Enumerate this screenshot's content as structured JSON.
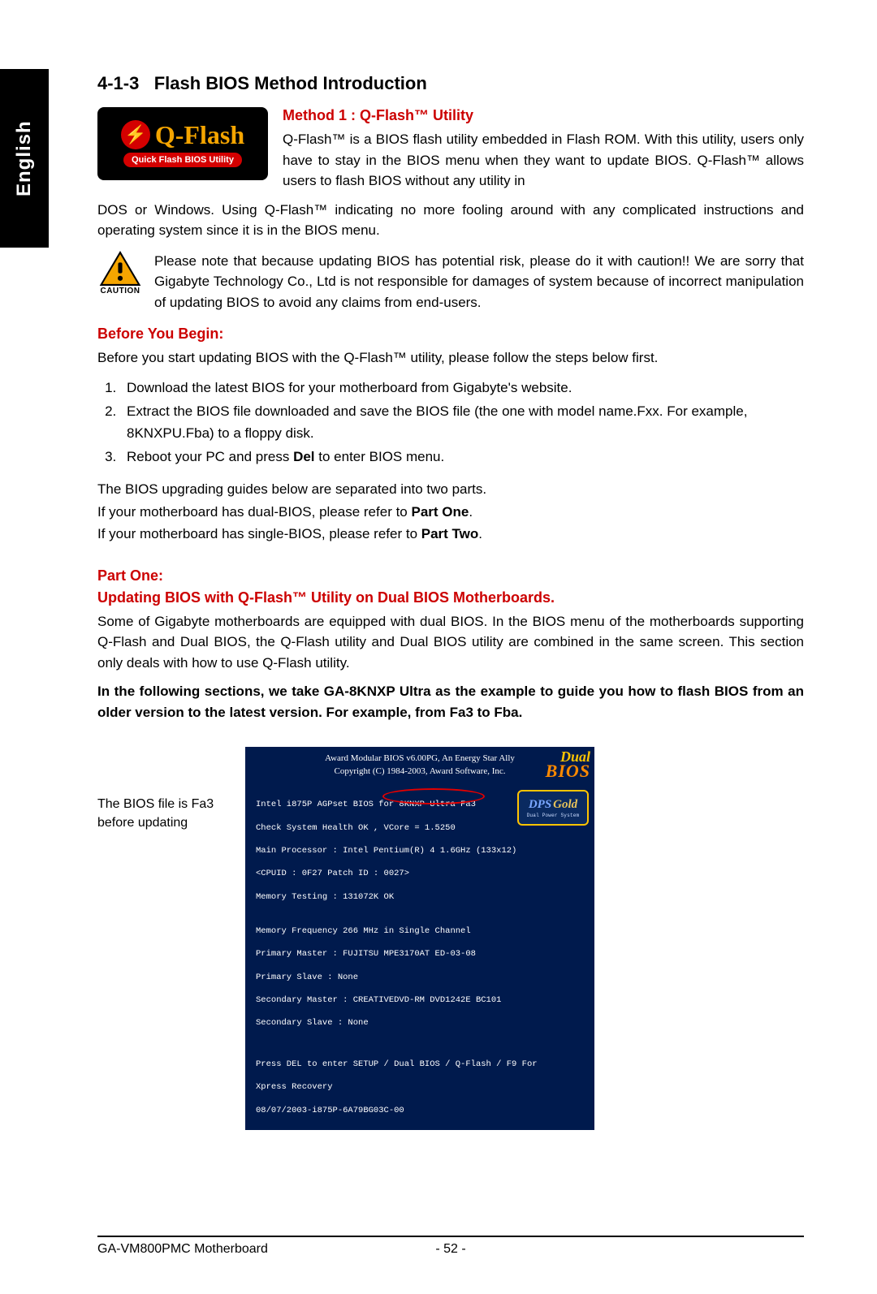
{
  "lang_tab": "English",
  "section_number": "4-1-3",
  "section_title": "Flash BIOS Method Introduction",
  "qflash_logo": {
    "main": "Q-Flash",
    "subtitle": "Quick Flash BIOS Utility",
    "symbol": "⚡"
  },
  "method_title": "Method 1 : Q-Flash™ Utility",
  "intro_paragraph_inline": "Q-Flash™ is a BIOS flash utility embedded in Flash ROM. With this utility, users only have to stay in the BIOS menu when they want to update BIOS. Q-Flash™ allows users to flash BIOS without any utility in",
  "intro_paragraph_cont": "DOS or Windows. Using Q-Flash™ indicating no more fooling around with any complicated instructions and operating system since it is in the BIOS menu.",
  "caution_label": "CAUTION",
  "caution_text": "Please note that because updating BIOS has potential risk, please do it with caution!! We are sorry that Gigabyte Technology Co., Ltd is not responsible for damages of system because of incorrect manipulation of updating BIOS to avoid any claims from end-users.",
  "before_heading": "Before You Begin:",
  "before_para": "Before you start updating BIOS with the Q-Flash™ utility, please follow the steps below first.",
  "steps": [
    "Download the latest BIOS for your motherboard from Gigabyte's website.",
    "Extract the BIOS file downloaded and save the BIOS file (the one with model name.Fxx. For example, 8KNXPU.Fba) to a floppy disk.",
    "Reboot your PC and press Del to enter BIOS menu."
  ],
  "guide_note_1": "The BIOS upgrading guides below are separated into two parts.",
  "guide_note_2a": "If your motherboard has dual-BIOS, please refer to ",
  "guide_note_2b": "Part One",
  "guide_note_2c": ".",
  "guide_note_3a": "If your motherboard has single-BIOS, please refer to ",
  "guide_note_3b": "Part Two",
  "guide_note_3c": ".",
  "part_one_heading": "Part One:",
  "part_one_sub": "Updating BIOS with Q-Flash™ Utility on Dual BIOS Motherboards.",
  "part_one_para": "Some of Gigabyte motherboards are equipped with dual BIOS. In the BIOS menu of the motherboards supporting Q-Flash and Dual BIOS, the Q-Flash utility and Dual BIOS utility are combined in the same screen. This section only deals with how to use Q-Flash utility.",
  "part_one_bold": "In the following sections, we take GA-8KNXP Ultra as the example to guide you how to flash BIOS from an older version to the latest version. For example, from Fa3 to Fba.",
  "fig_caption": "The BIOS file is Fa3 before updating",
  "bios": {
    "head1": "Award Modular BIOS v6.00PG, An Energy Star Ally",
    "head2": "Copyright (C) 1984-2003, Award Software, Inc.",
    "line1": "Intel i875P AGPset BIOS for 8KNXP Ultra Fa3",
    "line2": "Check System Health OK , VCore = 1.5250",
    "line3": "Main Processor : Intel Pentium(R) 4  1.6GHz (133x12)",
    "line4": "<CPUID : 0F27 Patch ID : 0027>",
    "line5": "Memory Testing  : 131072K OK",
    "line6": "Memory Frequency 266 MHz in Single Channel",
    "line7": "Primary Master : FUJITSU MPE3170AT ED-03-08",
    "line8": "Primary Slave : None",
    "line9": "Secondary Master : CREATIVEDVD-RM DVD1242E BC101",
    "line10": "Secondary Slave : None",
    "foot1": "Press DEL to enter SETUP / Dual BIOS / Q-Flash / F9 For",
    "foot2": "Xpress Recovery",
    "foot3": "08/07/2003-i875P-6A79BG03C-00"
  },
  "badge_dual_top": "Dual",
  "badge_dual_bottom": "BIOS",
  "badge_dps_main": "DPS",
  "badge_dps_gold": "Gold",
  "badge_dps_sub": "Dual Power System",
  "footer_model": "GA-VM800PMC Motherboard",
  "footer_page": "- 52 -"
}
